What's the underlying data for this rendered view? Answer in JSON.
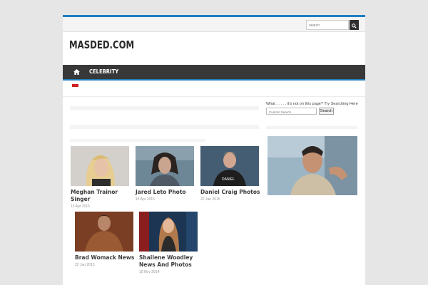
{
  "header": {
    "search_placeholder": "search"
  },
  "site": {
    "logo": "MASDED.COM"
  },
  "nav": {
    "items": [
      {
        "label": "CELEBRITY"
      }
    ]
  },
  "sidebar": {
    "prompt": "What . . . . . it's not on this page? Try Searching Here",
    "search_placeholder": "Custom Search",
    "search_button": "Search"
  },
  "posts": [
    {
      "title": "Meghan Trainor Singer",
      "date": "15 Apr 2015"
    },
    {
      "title": "Jared Leto Photo",
      "date": "15 Apr 2015"
    },
    {
      "title": "Daniel Craig Photos",
      "date": "22 Jan 2015"
    },
    {
      "title": "Brad Womack News",
      "date": "22 Jan 2015"
    },
    {
      "title": "Shailene Woodley News And Photos",
      "date": "19 Nov 2014"
    }
  ],
  "colors": {
    "accent": "#1e7fc0",
    "nav_bg": "#383838",
    "page_bg": "#e6e6e6"
  }
}
